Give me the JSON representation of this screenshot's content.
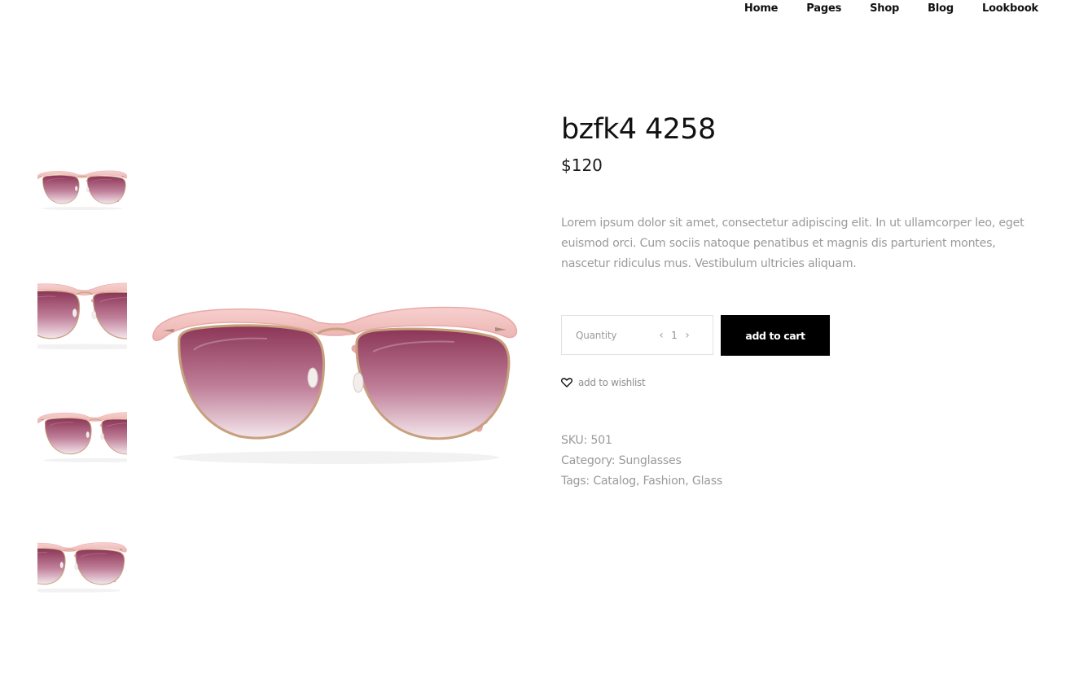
{
  "nav": {
    "items": [
      {
        "label": "Home"
      },
      {
        "label": "Pages"
      },
      {
        "label": "Shop"
      },
      {
        "label": "Blog"
      },
      {
        "label": "Lookbook"
      }
    ]
  },
  "product": {
    "title": "bzfk4 4258",
    "price": "$120",
    "description": "Lorem ipsum dolor sit amet, consectetur adipiscing elit. In ut ullamcorper leo, eget euismod orci. Cum sociis natoque penatibus et magnis dis parturient montes, nascetur ridiculus mus. Vestibulum ultricies aliquam.",
    "quantity_label": "Quantity",
    "quantity_value": "1",
    "add_to_cart_label": "add to cart",
    "wishlist_label": "add to wishlist",
    "sku_label": "SKU:",
    "sku_value": "501",
    "category_label": "Category:",
    "category_value": "Sunglasses",
    "tags_label": "Tags:",
    "tags": [
      {
        "label": "Catalog"
      },
      {
        "label": "Fashion"
      },
      {
        "label": "Glass"
      }
    ]
  },
  "icons": {
    "heart": "heart-icon",
    "quantity_decrease": "chevron-left-icon",
    "quantity_increase": "chevron-right-icon"
  },
  "colors": {
    "frame": "#f3c4c3",
    "lens": "#a34d6d",
    "button": "#000000"
  }
}
